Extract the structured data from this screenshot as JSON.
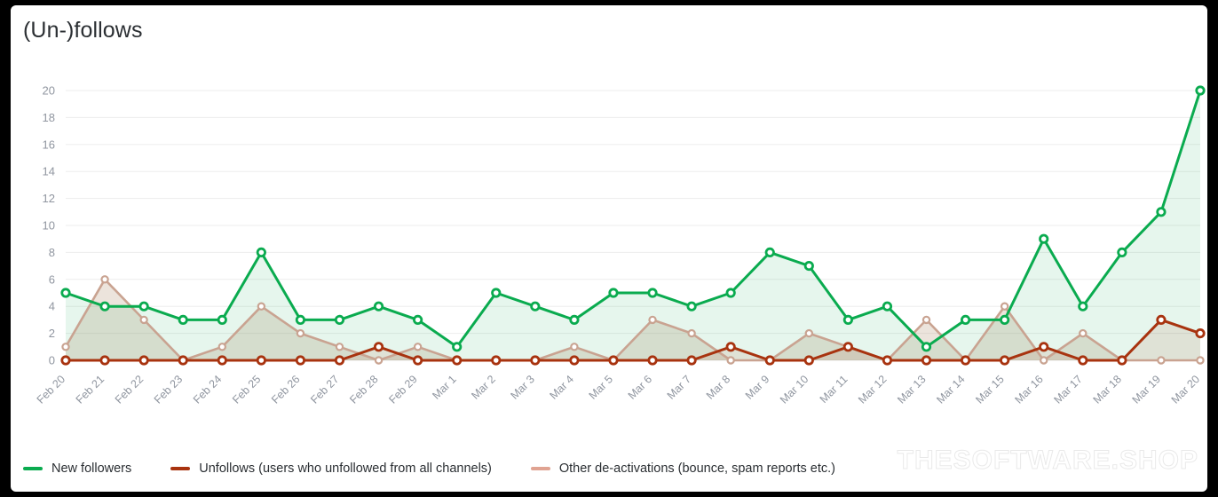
{
  "card": {
    "title": "(Un-)follows"
  },
  "watermark": {
    "text": "THESOFTWARE.SHOP"
  },
  "legend": [
    {
      "label": "New followers",
      "color": "#0aab4f",
      "swatch_name": "legend-swatch-new-followers"
    },
    {
      "label": "Unfollows (users who unfollowed from all channels)",
      "color": "#a8330f",
      "swatch_name": "legend-swatch-unfollows"
    },
    {
      "label": "Other de-activations (bounce, spam reports etc.)",
      "color": "#e0a392",
      "swatch_name": "legend-swatch-deactivations"
    }
  ],
  "chart_data": {
    "type": "line",
    "title": "(Un-)follows",
    "xlabel": "",
    "ylabel": "",
    "ylim": [
      0,
      20
    ],
    "yticks": [
      0,
      2,
      4,
      6,
      8,
      10,
      12,
      14,
      16,
      18,
      20
    ],
    "grid": true,
    "legend_position": "bottom",
    "area_fill": true,
    "markers": "open-circle",
    "categories": [
      "Feb 20",
      "Feb 21",
      "Feb 22",
      "Feb 23",
      "Feb 24",
      "Feb 25",
      "Feb 26",
      "Feb 27",
      "Feb 28",
      "Feb 29",
      "Mar 1",
      "Mar 2",
      "Mar 3",
      "Mar 4",
      "Mar 5",
      "Mar 6",
      "Mar 7",
      "Mar 8",
      "Mar 9",
      "Mar 10",
      "Mar 11",
      "Mar 12",
      "Mar 13",
      "Mar 14",
      "Mar 15",
      "Mar 16",
      "Mar 17",
      "Mar 18",
      "Mar 19",
      "Mar 20"
    ],
    "series": [
      {
        "name": "New followers",
        "color": "#0aab4f",
        "fill": "rgba(10,171,79,0.10)",
        "values": [
          5,
          4,
          4,
          3,
          3,
          8,
          3,
          3,
          4,
          3,
          1,
          5,
          4,
          3,
          5,
          5,
          4,
          5,
          8,
          7,
          3,
          4,
          1,
          3,
          3,
          9,
          4,
          8,
          11,
          20
        ]
      },
      {
        "name": "Unfollows (users who unfollowed from all channels)",
        "color": "#a8330f",
        "fill": "rgba(168,51,15,0.10)",
        "values": [
          0,
          0,
          0,
          0,
          0,
          0,
          0,
          0,
          1,
          0,
          0,
          0,
          0,
          0,
          0,
          0,
          0,
          1,
          0,
          0,
          1,
          0,
          0,
          0,
          0,
          1,
          0,
          0,
          3,
          2
        ]
      },
      {
        "name": "Other de-activations (bounce, spam reports etc.)",
        "color": "#c9a391",
        "fill": "rgba(180,150,120,0.26)",
        "values": [
          1,
          6,
          3,
          0,
          1,
          4,
          2,
          1,
          0,
          1,
          0,
          0,
          0,
          1,
          0,
          3,
          2,
          0,
          0,
          2,
          1,
          0,
          3,
          0,
          4,
          0,
          2,
          0,
          0,
          0
        ]
      }
    ]
  }
}
